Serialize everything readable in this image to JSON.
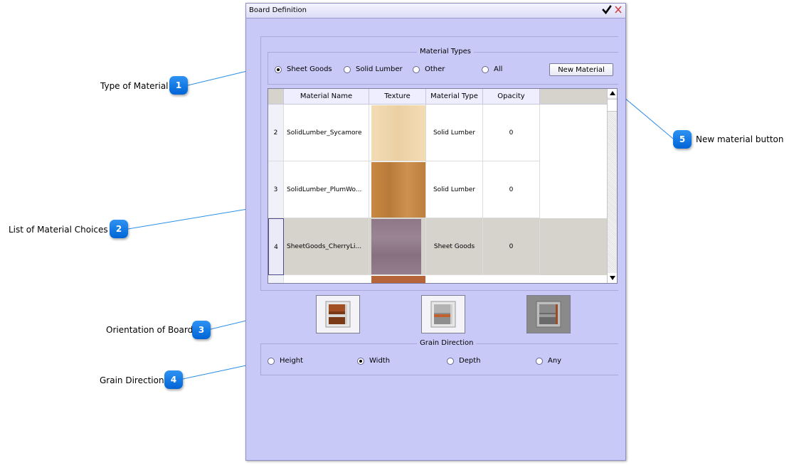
{
  "dialog": {
    "title": "Board Definition",
    "ok_icon": "checkmark-icon",
    "close_icon": "close-x-icon"
  },
  "material_types": {
    "legend": "Material Types",
    "options": [
      {
        "label": "Sheet Goods",
        "checked": true
      },
      {
        "label": "Solid Lumber",
        "checked": false
      },
      {
        "label": "Other",
        "checked": false
      },
      {
        "label": "All",
        "checked": false
      }
    ],
    "new_material_label": "New Material"
  },
  "table": {
    "columns": [
      "Material Name",
      "Texture",
      "Material Type",
      "Opacity"
    ],
    "rows": [
      {
        "num": "2",
        "name": "SolidLumber_Sycamore",
        "texture_color": "#f1d7ae",
        "type": "Solid Lumber",
        "opacity": "0",
        "selected": false
      },
      {
        "num": "3",
        "name": "SolidLumber_PlumWo...",
        "texture_color": "#c98a45",
        "type": "Solid Lumber",
        "opacity": "0",
        "selected": false
      },
      {
        "num": "4",
        "name": "SheetGoods_CherryLi...",
        "texture_color": "#8f7a8a",
        "type": "Sheet Goods",
        "opacity": "0",
        "selected": true
      }
    ]
  },
  "orientation": {
    "buttons": [
      "orientation-height-icon",
      "orientation-width-icon",
      "orientation-depth-icon"
    ]
  },
  "grain_direction": {
    "legend": "Grain Direction",
    "options": [
      {
        "label": "Height",
        "checked": false
      },
      {
        "label": "Width",
        "checked": true
      },
      {
        "label": "Depth",
        "checked": false
      },
      {
        "label": "Any",
        "checked": false
      }
    ]
  },
  "callouts": [
    {
      "num": "1",
      "label": "Type of Material"
    },
    {
      "num": "2",
      "label": "List of Material Choices"
    },
    {
      "num": "3",
      "label": "Orientation of Board"
    },
    {
      "num": "4",
      "label": "Grain Direction"
    },
    {
      "num": "5",
      "label": "New material button"
    }
  ],
  "colors": {
    "dialog_bg": "#c9c9f7",
    "badge": "#1a7ee8",
    "leader_line": "#2b8ee8",
    "selected_row": "#d6d3cd"
  }
}
